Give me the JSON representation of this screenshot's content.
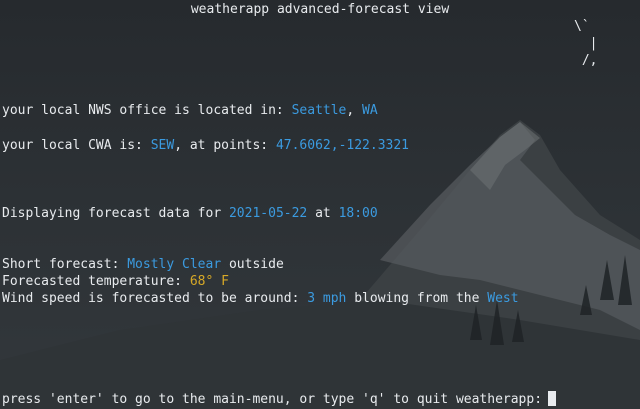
{
  "title": "weatherapp advanced-forecast view",
  "ascii_art": "\\`\n  |\n /,",
  "office": {
    "prefix": "your local NWS office is located in: ",
    "city": "Seattle",
    "sep": ", ",
    "state": "WA"
  },
  "cwa": {
    "prefix": "your local CWA is: ",
    "code": "SEW",
    "mid": ", at points: ",
    "points": "47.6062,-122.3321"
  },
  "forecast_time": {
    "prefix": "Displaying forecast data for ",
    "date": "2021-05-22",
    "mid": " at ",
    "time": "18:00"
  },
  "short_forecast": {
    "prefix": "Short forecast: ",
    "value": "Mostly Clear",
    "suffix": " outside"
  },
  "temperature": {
    "prefix": "Forecasted temperature: ",
    "value": "68° F"
  },
  "wind": {
    "prefix": "Wind speed is forecasted to be around: ",
    "speed": "3 mph",
    "mid": " blowing from the ",
    "direction": "West"
  },
  "prompt": "press 'enter' to go to the main-menu, or type 'q' to quit weatherapp:",
  "colors": {
    "accent_blue": "#3b9be0",
    "accent_yellow": "#d7a927",
    "text": "#e8ebee",
    "background": "#2b2f33"
  }
}
